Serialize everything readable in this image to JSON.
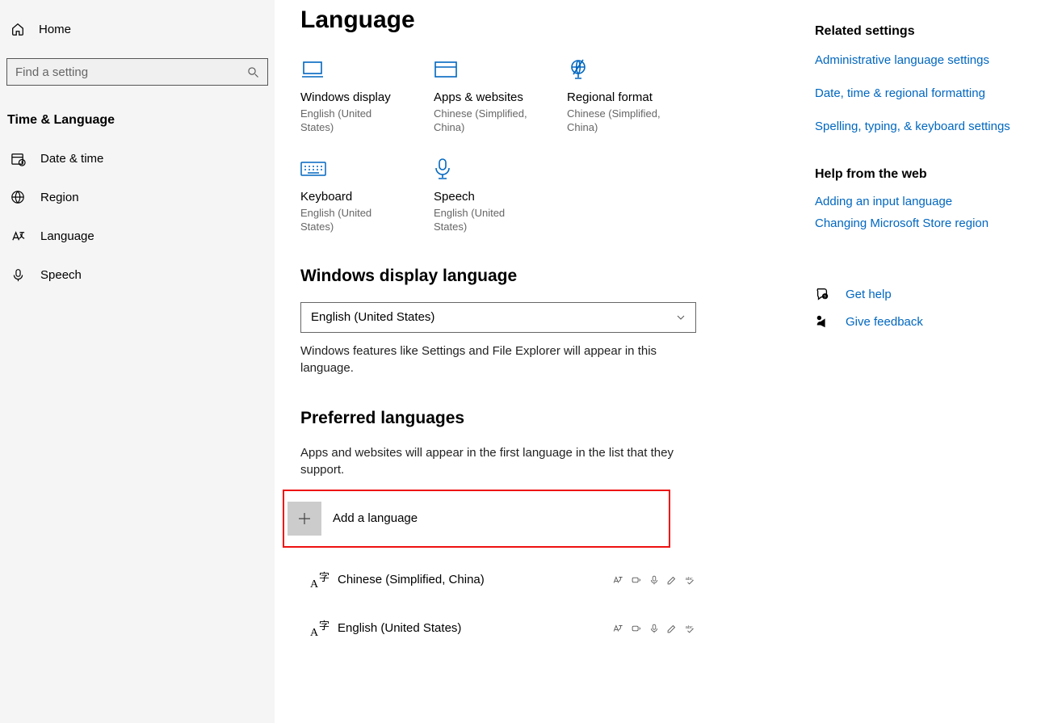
{
  "sidebar": {
    "home": "Home",
    "search_placeholder": "Find a setting",
    "section": "Time & Language",
    "items": [
      {
        "label": "Date & time"
      },
      {
        "label": "Region"
      },
      {
        "label": "Language"
      },
      {
        "label": "Speech"
      }
    ]
  },
  "page": {
    "title": "Language",
    "cards": [
      {
        "title": "Windows display",
        "sub": "English (United States)"
      },
      {
        "title": "Apps & websites",
        "sub": "Chinese (Simplified, China)"
      },
      {
        "title": "Regional format",
        "sub": "Chinese (Simplified, China)"
      },
      {
        "title": "Keyboard",
        "sub": "English (United States)"
      },
      {
        "title": "Speech",
        "sub": "English (United States)"
      }
    ],
    "display_heading": "Windows display language",
    "display_value": "English (United States)",
    "display_desc": "Windows features like Settings and File Explorer will appear in this language.",
    "preferred_heading": "Preferred languages",
    "preferred_desc": "Apps and websites will appear in the first language in the list that they support.",
    "add_label": "Add a language",
    "langs": [
      {
        "label": "Chinese (Simplified, China)"
      },
      {
        "label": "English (United States)"
      }
    ]
  },
  "right": {
    "related_heading": "Related settings",
    "related_links": [
      "Administrative language settings",
      "Date, time & regional formatting",
      "Spelling, typing, & keyboard settings"
    ],
    "help_heading": "Help from the web",
    "help_links": [
      "Adding an input language",
      "Changing Microsoft Store region"
    ],
    "get_help": "Get help",
    "feedback": "Give feedback"
  }
}
